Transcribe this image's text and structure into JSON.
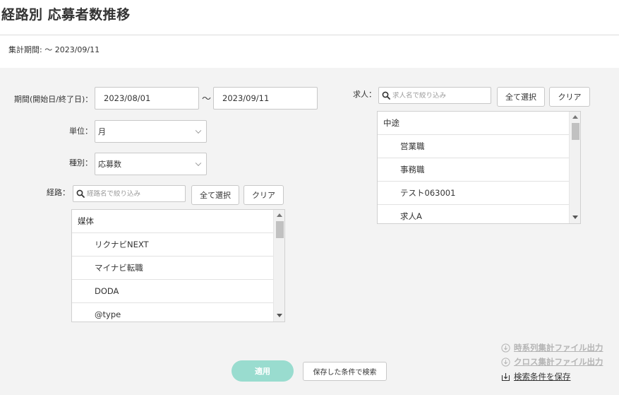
{
  "page": {
    "title": "経路別 応募者数推移",
    "period_summary": "集計期間: 〜 2023/09/11"
  },
  "period": {
    "label": "期間(開始日/終了日)：",
    "start": "2023/08/01",
    "separator": "〜",
    "end": "2023/09/11"
  },
  "unit": {
    "label": "単位：",
    "value": "月"
  },
  "kind": {
    "label": "種別：",
    "value": "応募数"
  },
  "route": {
    "label": "経路：",
    "search_placeholder": "経路名で絞り込み",
    "select_all": "全て選択",
    "clear": "クリア",
    "items": [
      {
        "label": "媒体",
        "level": "group"
      },
      {
        "label": "リクナビNEXT",
        "level": "child"
      },
      {
        "label": "マイナビ転職",
        "level": "child"
      },
      {
        "label": "DODA",
        "level": "child"
      },
      {
        "label": "@type",
        "level": "child"
      }
    ]
  },
  "job": {
    "label": "求人：",
    "search_placeholder": "求人名で絞り込み",
    "select_all": "全て選択",
    "clear": "クリア",
    "items": [
      {
        "label": "中途",
        "level": "group"
      },
      {
        "label": "営業職",
        "level": "child"
      },
      {
        "label": "事務職",
        "level": "child"
      },
      {
        "label": "テスト063001",
        "level": "child"
      },
      {
        "label": "求人A",
        "level": "child"
      }
    ]
  },
  "actions": {
    "apply": "適用",
    "search_saved": "保存した条件で検索"
  },
  "side_links": {
    "timeseries_export": "時系列集計ファイル出力",
    "cross_export": "クロス集計ファイル出力",
    "save_conditions": "検索条件を保存"
  }
}
